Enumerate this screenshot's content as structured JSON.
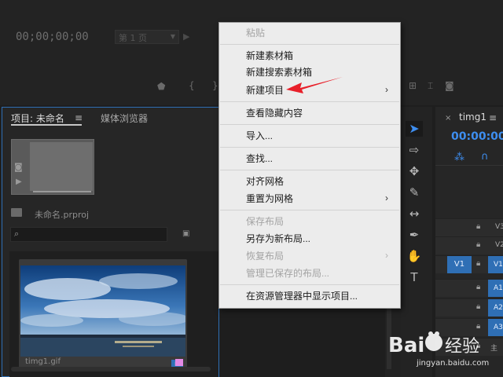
{
  "program_monitor": {
    "timecode": "00;00;00;00",
    "page_select": "第 1 页"
  },
  "project_panel": {
    "tab_label": "项目: 未命名",
    "tab_menu": "≡",
    "media_browser_tab": "媒体浏览器",
    "project_file": "未命名.prproj",
    "search_placeholder": "",
    "clip_name": "timg1.gif"
  },
  "context_menu": {
    "items": [
      {
        "label": "粘贴",
        "enabled": false
      },
      {
        "label": "新建素材箱",
        "enabled": true
      },
      {
        "label": "新建搜索素材箱",
        "enabled": true
      },
      {
        "label": "新建项目",
        "enabled": true,
        "submenu": true
      },
      {
        "label": "查看隐藏内容",
        "enabled": true
      },
      {
        "label": "导入...",
        "enabled": true
      },
      {
        "label": "查找...",
        "enabled": true
      },
      {
        "label": "对齐网格",
        "enabled": true
      },
      {
        "label": "重置为网格",
        "enabled": true,
        "submenu": true
      },
      {
        "label": "保存布局",
        "enabled": false
      },
      {
        "label": "另存为新布局...",
        "enabled": true
      },
      {
        "label": "恢复布局",
        "enabled": false,
        "submenu": true
      },
      {
        "label": "管理已保存的布局...",
        "enabled": false
      },
      {
        "label": "在资源管理器中显示项目...",
        "enabled": true
      }
    ],
    "submenu_arrow": "›"
  },
  "timeline": {
    "tab_label": "timg1",
    "close": "×",
    "menu": "≡",
    "timecode": "00:00:00",
    "tracks": {
      "v3": "V3",
      "v2": "V2",
      "v1": "V1",
      "a1": "A1",
      "a2": "A2",
      "a3": "A3",
      "master": "主"
    },
    "source_v1": "V1"
  },
  "watermark": {
    "brand": "Baidu经验",
    "url": "jingyan.baidu.com"
  },
  "colors": {
    "accent": "#2f6fb5",
    "highlight": "#3e8ef0",
    "arrow": "#e8202a",
    "label_pink": "#e38ae6"
  }
}
